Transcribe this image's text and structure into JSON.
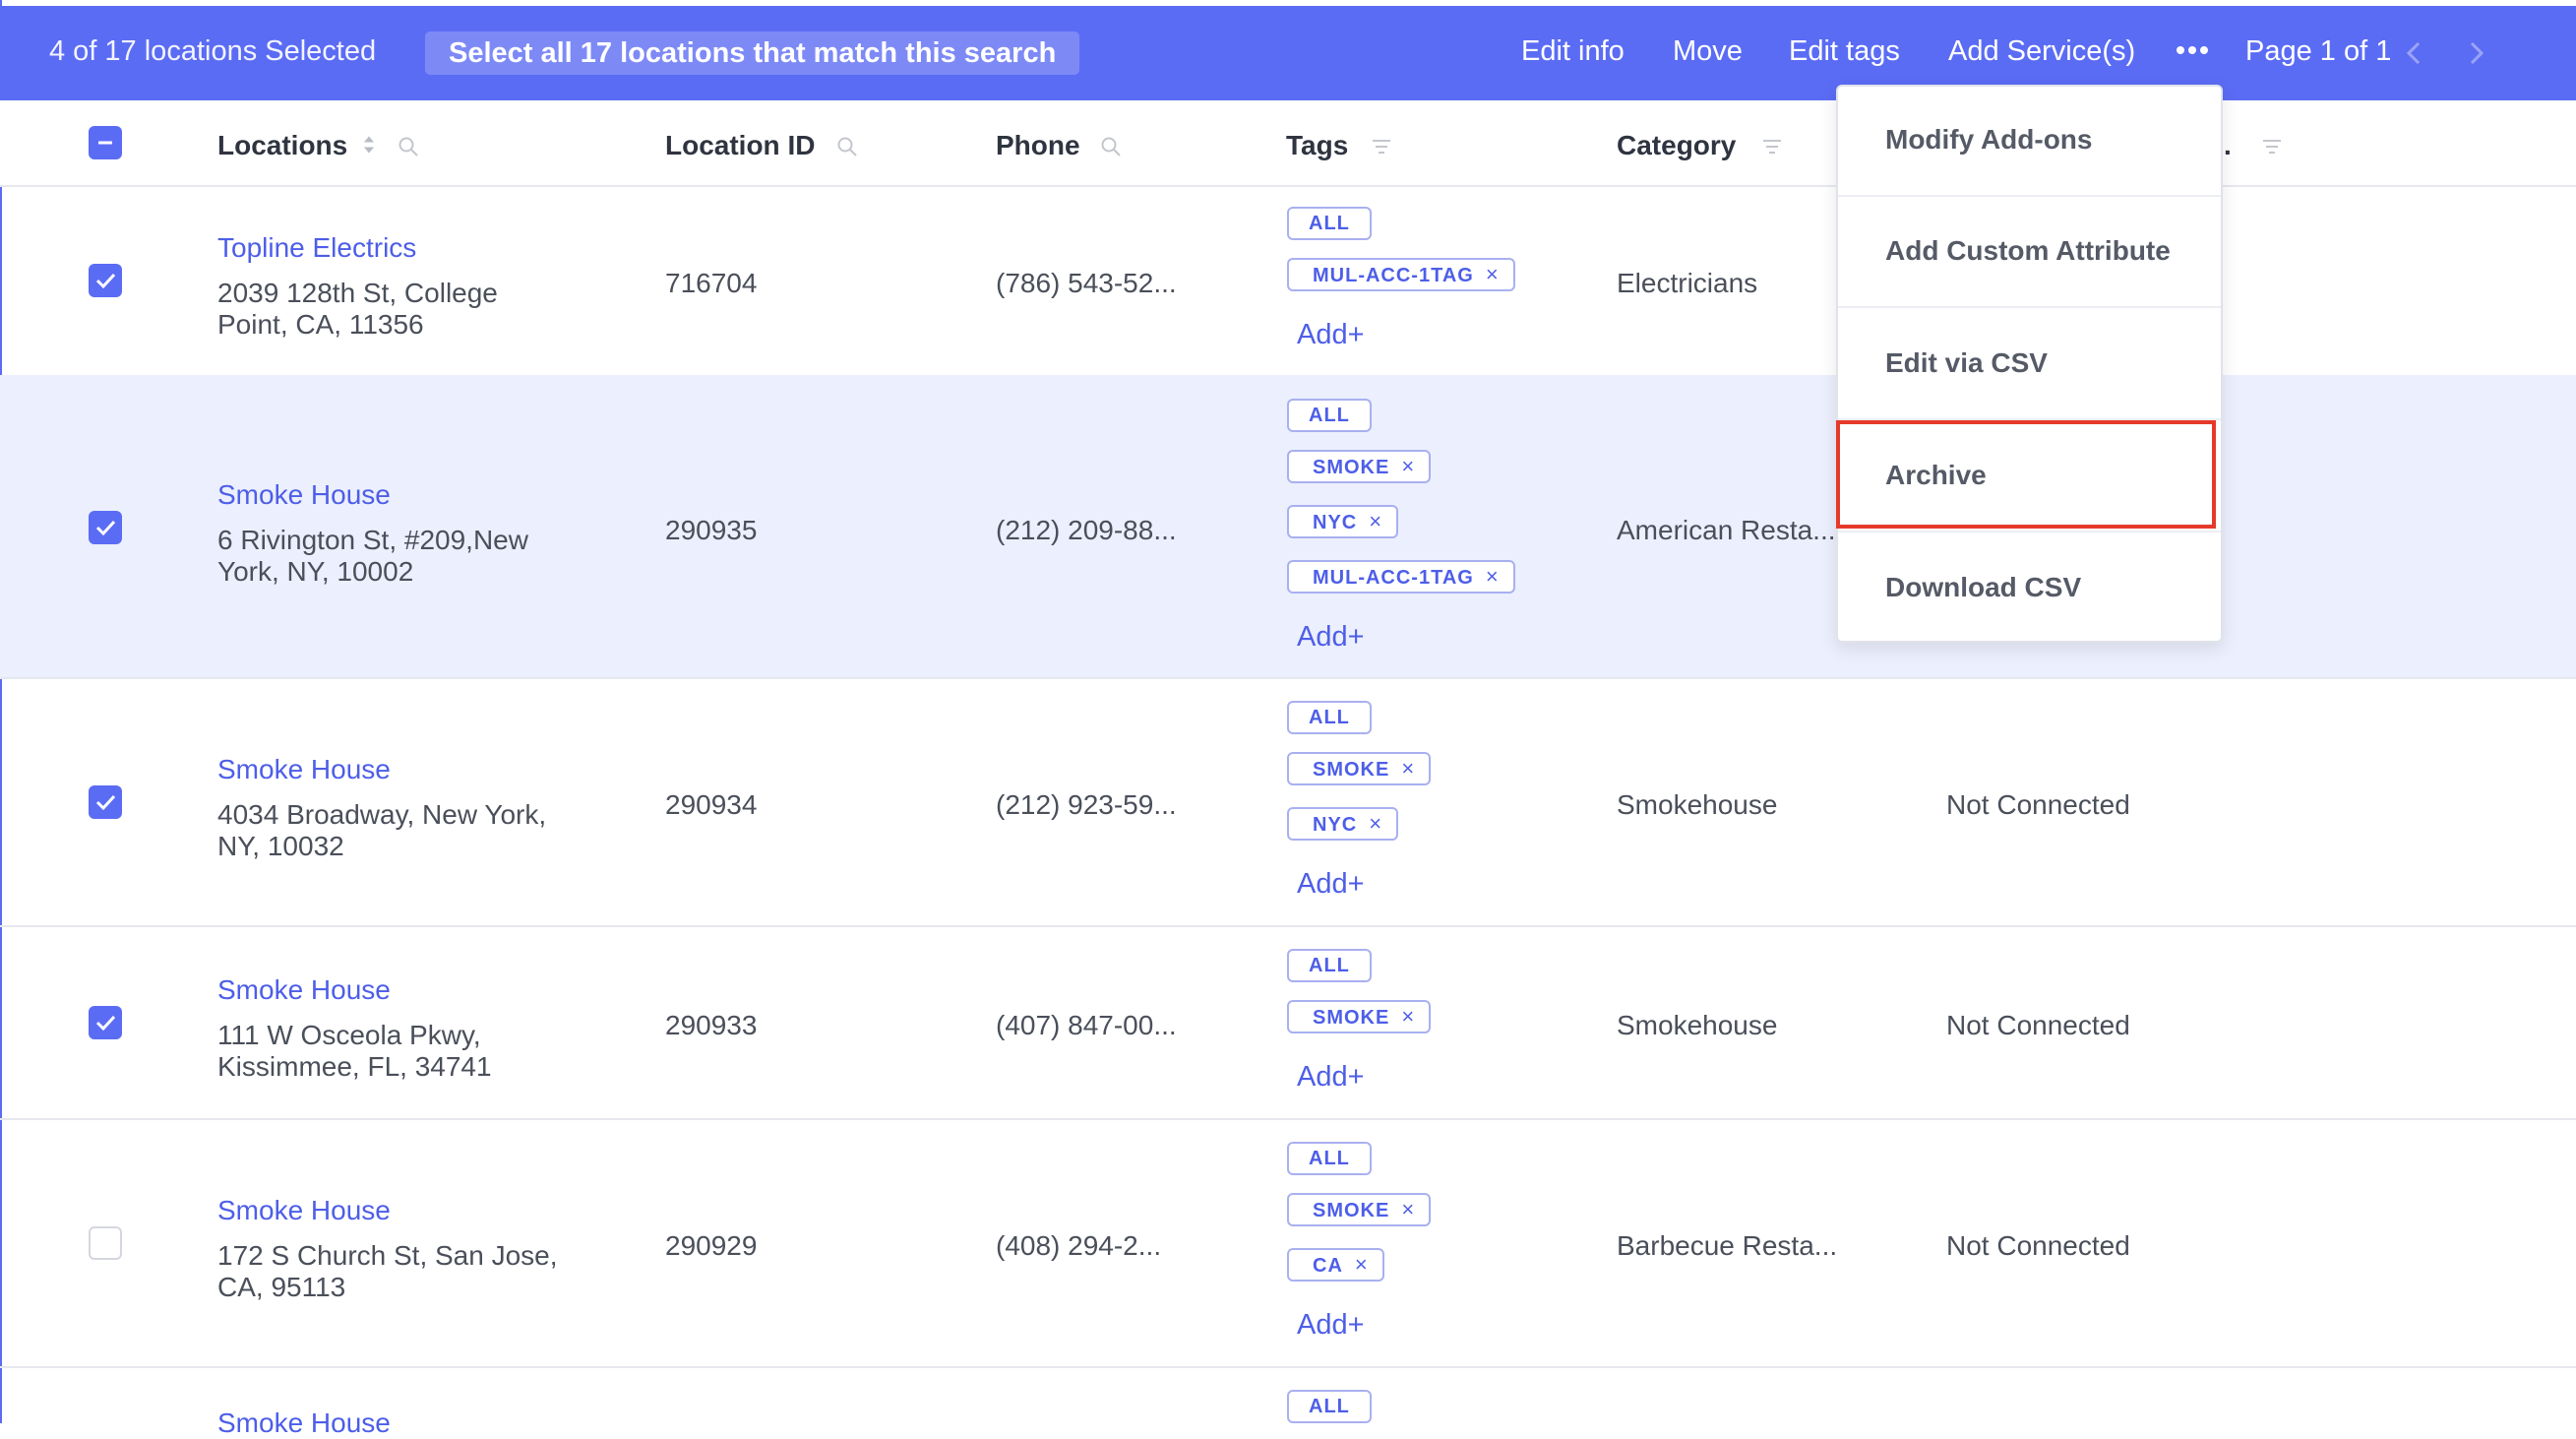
{
  "topbar": {
    "selection_text": "4 of 17 locations Selected",
    "select_all_label": "Select all 17 locations that match this search",
    "actions": [
      "Edit info",
      "Move",
      "Edit tags",
      "Add Service(s)"
    ],
    "page_info": "Page 1 of 1"
  },
  "columns": {
    "locations": "Locations",
    "location_id": "Location ID",
    "phone": "Phone",
    "tags": "Tags",
    "category": "Category",
    "hidden_col_tail": "."
  },
  "dropdown": {
    "items": [
      "Modify Add-ons",
      "Add Custom Attribute",
      "Edit via CSV",
      "Archive",
      "Download CSV"
    ],
    "highlighted": "Archive"
  },
  "add_label": "Add+",
  "tag_remove_glyph": "×",
  "rows": [
    {
      "checked": true,
      "name": "Topline Electrics",
      "address_line1": "2039 128th St, College",
      "address_line2": "Point, CA, 11356",
      "id": "716704",
      "phone": "(786) 543-52...",
      "tags": [
        "ALL",
        "MUL-ACC-1TAG"
      ],
      "category": "Electricians",
      "status": ""
    },
    {
      "checked": true,
      "name": "Smoke House",
      "address_line1": "6 Rivington St, #209,New",
      "address_line2": "York, NY, 10002",
      "id": "290935",
      "phone": "(212) 209-88...",
      "tags": [
        "ALL",
        "SMOKE",
        "NYC",
        "MUL-ACC-1TAG"
      ],
      "category": "American Resta...",
      "status": ""
    },
    {
      "checked": true,
      "name": "Smoke House",
      "address_line1": "4034 Broadway, New York,",
      "address_line2": "NY, 10032",
      "id": "290934",
      "phone": "(212) 923-59...",
      "tags": [
        "ALL",
        "SMOKE",
        "NYC"
      ],
      "category": "Smokehouse",
      "status": "Not Connected"
    },
    {
      "checked": true,
      "name": "Smoke House",
      "address_line1": "111 W Osceola Pkwy,",
      "address_line2": "Kissimmee, FL, 34741",
      "id": "290933",
      "phone": "(407) 847-00...",
      "tags": [
        "ALL",
        "SMOKE"
      ],
      "category": "Smokehouse",
      "status": "Not Connected"
    },
    {
      "checked": false,
      "name": "Smoke House",
      "address_line1": "172 S Church St, San Jose,",
      "address_line2": "CA, 95113",
      "id": "290929",
      "phone": "(408) 294-2...",
      "tags": [
        "ALL",
        "SMOKE",
        "CA"
      ],
      "category": "Barbecue Resta...",
      "status": "Not Connected"
    },
    {
      "checked": false,
      "name": "Smoke House",
      "tags": [
        "ALL"
      ]
    }
  ],
  "colors": {
    "accent": "#5b6cf4",
    "link": "#4d5ee8",
    "highlight_row": "#eceffd",
    "archive_outline": "#e53a2b"
  }
}
